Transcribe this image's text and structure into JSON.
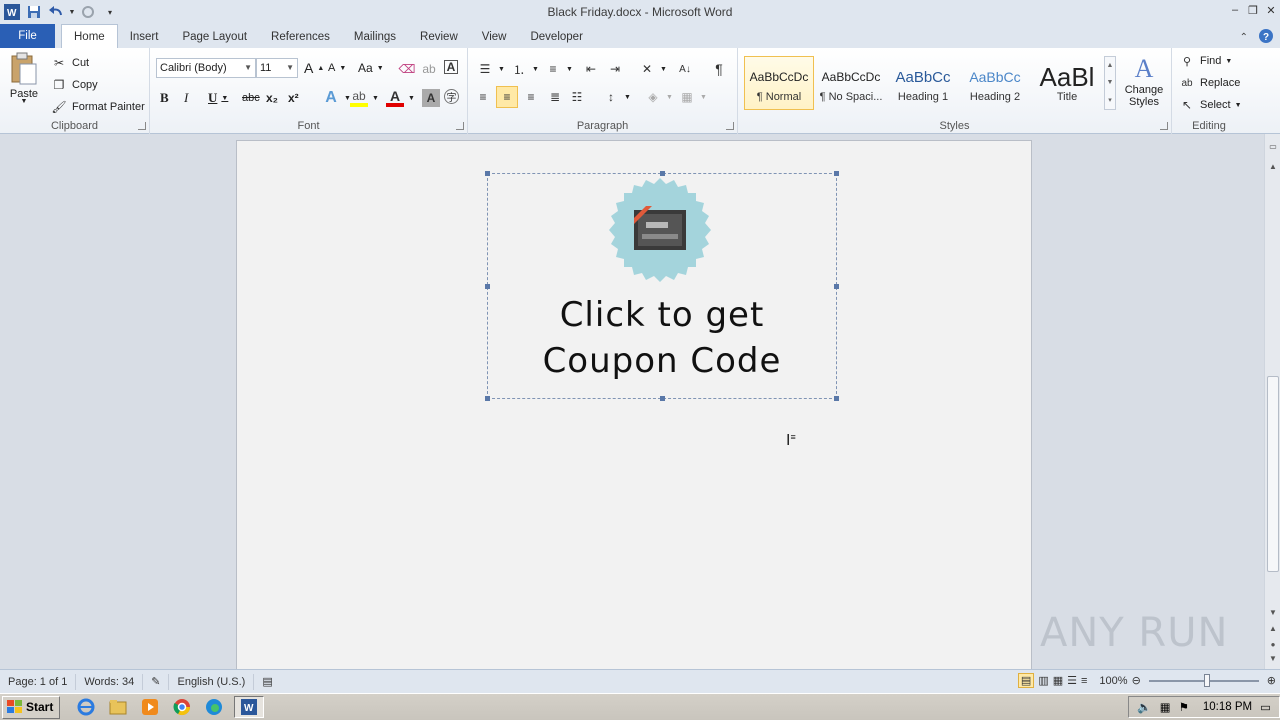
{
  "window": {
    "title": "Black Friday.docx - Microsoft Word",
    "controls": [
      "minimize",
      "restore",
      "close"
    ]
  },
  "tabs": [
    {
      "label": "File"
    },
    {
      "label": "Home"
    },
    {
      "label": "Insert"
    },
    {
      "label": "Page Layout"
    },
    {
      "label": "References"
    },
    {
      "label": "Mailings"
    },
    {
      "label": "Review"
    },
    {
      "label": "View"
    },
    {
      "label": "Developer"
    }
  ],
  "ribbon": {
    "clipboard": {
      "group_label": "Clipboard",
      "paste": "Paste",
      "cut": "Cut",
      "copy": "Copy",
      "format_painter": "Format Painter"
    },
    "font": {
      "group_label": "Font",
      "font_name": "Calibri (Body)",
      "font_size": "11",
      "bold": "B",
      "italic": "I",
      "underline": "U",
      "strike": "abc",
      "grow": "A",
      "shrink": "A",
      "change_case": "Aa",
      "subscript": "x₂",
      "superscript": "x²"
    },
    "paragraph": {
      "group_label": "Paragraph",
      "pilcrow": "¶"
    },
    "styles": {
      "group_label": "Styles",
      "items": [
        {
          "preview": "AaBbCcDc",
          "name": "¶ Normal"
        },
        {
          "preview": "AaBbCcDc",
          "name": "¶ No Spaci..."
        },
        {
          "preview": "AaBbCc",
          "name": "Heading 1"
        },
        {
          "preview": "AaBbCc",
          "name": "Heading 2"
        },
        {
          "preview": "AaBl",
          "name": "Title"
        }
      ],
      "change_styles": "Change Styles"
    },
    "editing": {
      "group_label": "Editing",
      "find": "Find",
      "replace": "Replace",
      "select": "Select"
    }
  },
  "document": {
    "coupon_line1": "Click to get",
    "coupon_line2": "Coupon Code"
  },
  "statusbar": {
    "page": "Page: 1 of 1",
    "words": "Words: 34",
    "language": "English (U.S.)",
    "zoom": "100%",
    "zoom_level": 1.0
  },
  "taskbar": {
    "start": "Start",
    "clock": "10:18 PM"
  },
  "watermark": "ANY RUN",
  "colors": {
    "file_tab": "#2a5fb5",
    "badge": "#a4d4dc",
    "selected_style": "#f0c050"
  }
}
